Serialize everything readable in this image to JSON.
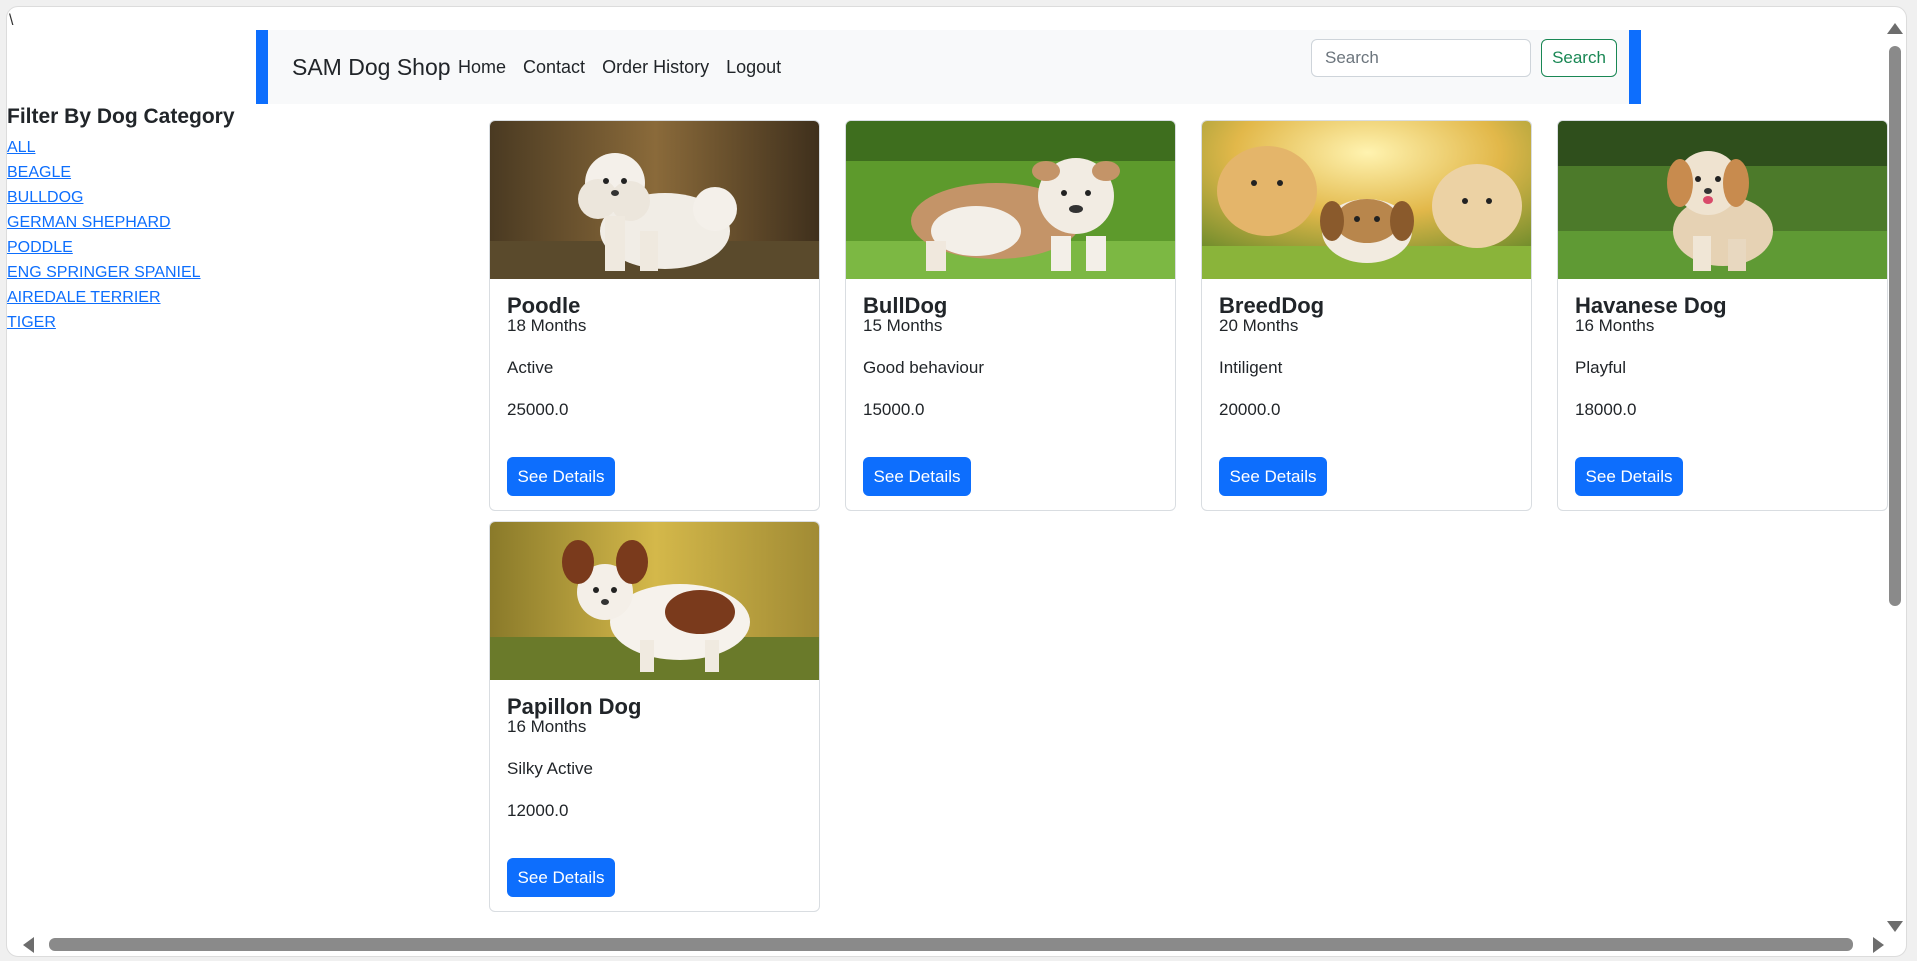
{
  "stray_char": "\\",
  "navbar": {
    "brand": "SAM Dog Shop",
    "links": [
      "Home",
      "Contact",
      "Order History",
      "Logout"
    ],
    "search_placeholder": "Search",
    "search_button": "Search",
    "accent_color": "#0d6efd"
  },
  "sidebar": {
    "title": "Filter By Dog Category",
    "categories": [
      "ALL",
      "BEAGLE",
      "BULLDOG",
      "GERMAN SHEPHARD",
      "PODDLE",
      "ENG SPRINGER SPANIEL",
      "AIREDALE TERRIER",
      "TIGER"
    ]
  },
  "products": [
    {
      "name": "Poodle",
      "age": "18 Months",
      "trait": "Active",
      "price": "25000.0",
      "button": "See Details",
      "image": "white-poodle-photo"
    },
    {
      "name": "BullDog",
      "age": "15 Months",
      "trait": "Good behaviour",
      "price": "15000.0",
      "button": "See Details",
      "image": "bulldog-puppy-photo"
    },
    {
      "name": "BreedDog",
      "age": "20 Months",
      "trait": "Intiligent",
      "price": "20000.0",
      "button": "See Details",
      "image": "three-puppies-photo"
    },
    {
      "name": "Havanese Dog",
      "age": "16 Months",
      "trait": "Playful",
      "price": "18000.0",
      "button": "See Details",
      "image": "havanese-photo"
    },
    {
      "name": "Papillon Dog",
      "age": "16 Months",
      "trait": "Silky Active",
      "price": "12000.0",
      "button": "See Details",
      "image": "papillon-photo"
    }
  ]
}
